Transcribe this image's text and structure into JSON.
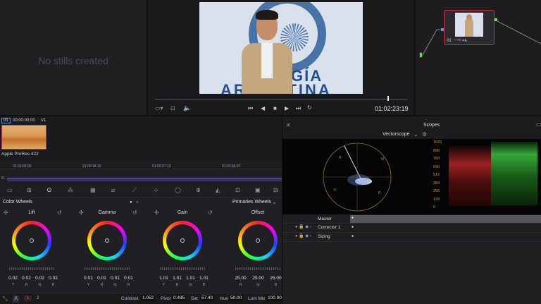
{
  "gallery": {
    "empty_text": "No stills created"
  },
  "viewer": {
    "overlay_lines": [
      "GÍA",
      "ARGENTINA"
    ],
    "timecode": "01:02:23:19"
  },
  "node": {
    "label": "01"
  },
  "clips": {
    "number": "01",
    "timecode": "00:00:00:00",
    "track": "V1",
    "codec": "Apple ProRes 422"
  },
  "mini_timeline": {
    "ticks": [
      "01:00:00:00",
      "01:00:18:19",
      "01:00:37:13",
      "01:00:56:07"
    ],
    "track": "V1"
  },
  "color": {
    "title": "Color Wheels",
    "mode": "Primaries Wheels",
    "wheels": [
      {
        "name": "Lift",
        "values": [
          "0.02",
          "0.02",
          "0.02",
          "0.02"
        ]
      },
      {
        "name": "Gamma",
        "values": [
          "0.01",
          "0.01",
          "0.01",
          "0.01"
        ]
      },
      {
        "name": "Gain",
        "values": [
          "1.01",
          "1.01",
          "1.01",
          "1.01"
        ]
      },
      {
        "name": "Offset",
        "values": [
          "25.00",
          "25.00",
          "25.00"
        ]
      }
    ],
    "channel_labels_4": [
      "Y",
      "R",
      "G",
      "B"
    ],
    "channel_labels_3": [
      "R",
      "G",
      "B"
    ]
  },
  "bottom_bar": {
    "page1": "1",
    "page2": "2",
    "contrast_label": "Contrast",
    "contrast": "1.052",
    "pivot_label": "Pivot",
    "pivot": "0.435",
    "sat_label": "Sat",
    "sat": "57.40",
    "hue_label": "Hue",
    "hue": "50.00",
    "lummix_label": "Lum Mix",
    "lummix": "100.00"
  },
  "scopes": {
    "title": "Scopes",
    "mode": "Vectorscope",
    "scale": [
      "1023",
      "896",
      "768",
      "640",
      "512",
      "384",
      "256",
      "128",
      "0"
    ]
  },
  "keyframes": {
    "rows": [
      "Master",
      "Corrector 1",
      "Sizing"
    ]
  }
}
